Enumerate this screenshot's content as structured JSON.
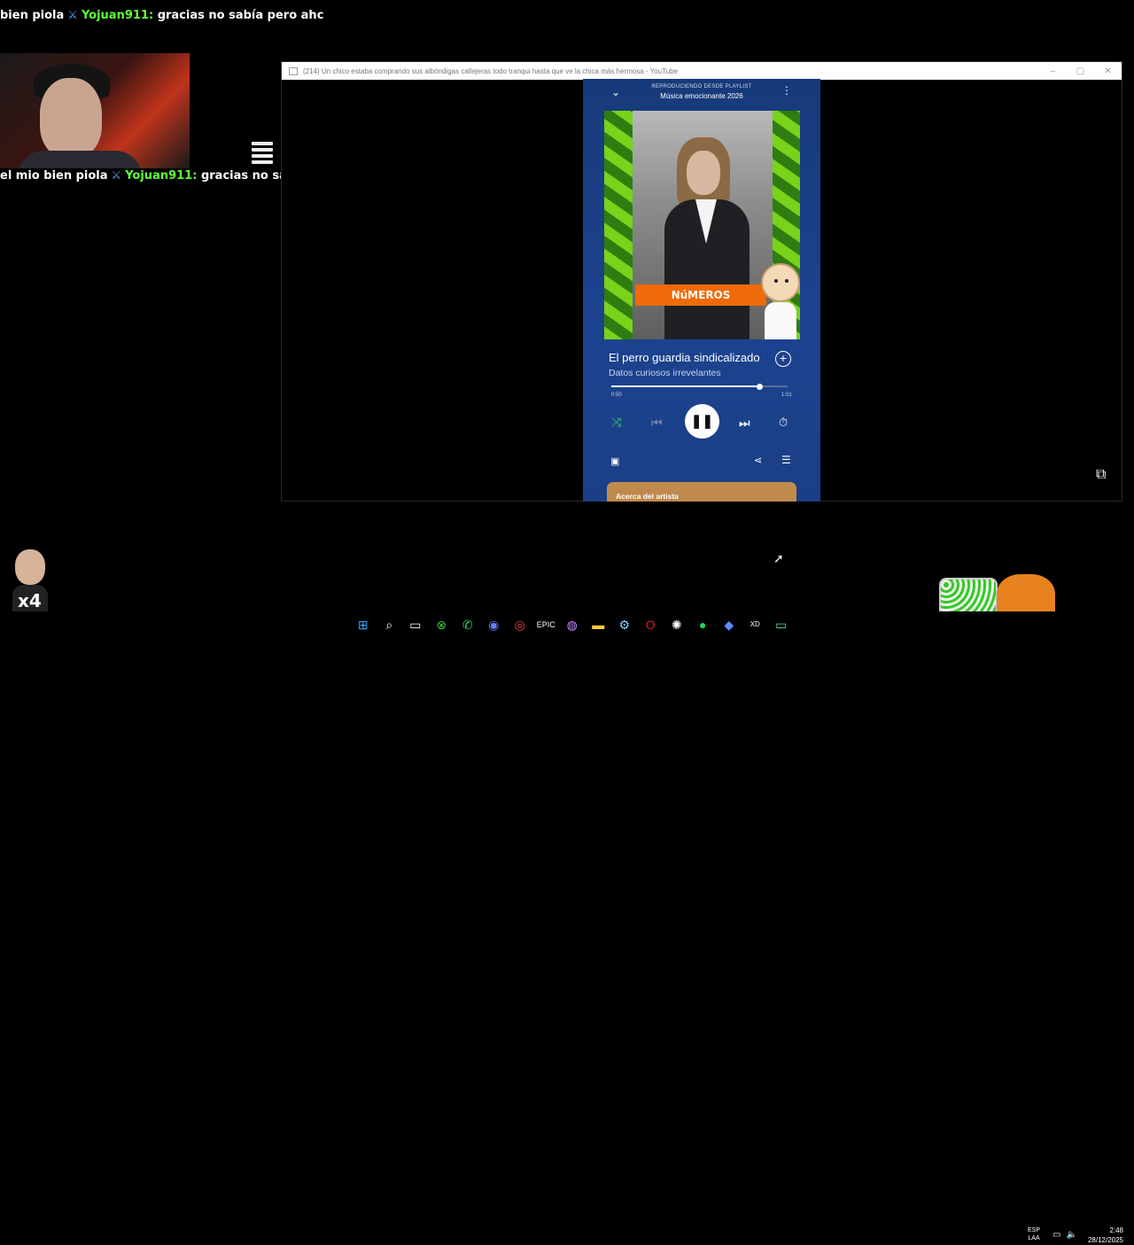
{
  "chat": {
    "line1": {
      "prefix": "bien piola",
      "user": "Yojuan911:",
      "message": "gracias no sabía pero ahc"
    },
    "line2": {
      "prefix": "el mio bien piola",
      "user": "Yojuan911:",
      "message": "gracias no sal"
    }
  },
  "overlay": {
    "multiplier": "x4"
  },
  "window": {
    "title": "(214) Un chico estaba comprando sus albóndigas callejeras todo tranqui hasta que ve la chica más hermosa - YouTube",
    "controls": [
      "–",
      "▢",
      "✕"
    ]
  },
  "player": {
    "context_label": "REPRODUCIENDO DESDE PLAYLIST",
    "playlist_name": "Música emocionante 2026",
    "cover_banner": "NúMEROS",
    "track_title": "El perro guardia sindicalizado",
    "artist": "Datos curiosos irrevelantes",
    "time_current": "0:50",
    "time_total": "1:01",
    "progress_fraction": 0.84,
    "about_label": "Acerca del artista",
    "accent_color": "#2fd35e",
    "icons": [
      "chevron-down-icon",
      "more-icon",
      "add-icon",
      "shuffle-icon",
      "previous-icon",
      "pause-icon",
      "next-icon",
      "timer-icon",
      "device-icon",
      "share-icon",
      "queue-icon"
    ]
  },
  "taskbar": {
    "icons": [
      "windows-icon",
      "search-icon",
      "task-view-icon",
      "xbox-icon",
      "whatsapp-icon",
      "discord-icon",
      "opera-gx-icon",
      "epic-games-icon",
      "browser-icon",
      "file-explorer-icon",
      "steam-icon",
      "opera-icon",
      "chatgpt-icon",
      "spotify-icon",
      "app-icon",
      "xd-pen-icon",
      "terminal-icon"
    ],
    "lang_top": "ESP",
    "lang_bottom": "LAA",
    "time": "2:48",
    "date": "28/12/2025"
  }
}
